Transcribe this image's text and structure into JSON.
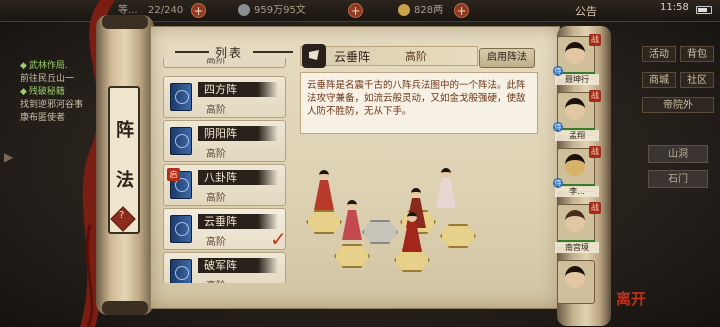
{
  "topbar": {
    "level_text": "等...",
    "stamina": "22/240",
    "silver": "959万95文",
    "gold": "828两",
    "announcement": "公告",
    "time": "11:58"
  },
  "quest": {
    "item1_title": "武林作局.",
    "item1_desc": "前往民丘山一",
    "item2_title": "残破秘籍",
    "item2_desc": "找到逆邪河谷事",
    "item2_desc2": "康布匿使者"
  },
  "right_menu": {
    "btn1": "活动",
    "btn2": "背包",
    "btn3": "商城",
    "btn4": "社区",
    "btn5": "帝院外",
    "btn6": "山洞",
    "btn7": "石门"
  },
  "left_tab": {
    "char1": "阵",
    "char2": "法",
    "seal": "?"
  },
  "list": {
    "header": "列表",
    "items": [
      {
        "name": "四方阵",
        "tier": "高阶",
        "badge": "",
        "selected": false
      },
      {
        "name": "阴阳阵",
        "tier": "高阶",
        "badge": "",
        "selected": false
      },
      {
        "name": "八卦阵",
        "tier": "高阶",
        "badge": "启",
        "selected": false
      },
      {
        "name": "云垂阵",
        "tier": "高阶",
        "badge": "",
        "selected": true
      },
      {
        "name": "破军阵",
        "tier": "高阶",
        "badge": "",
        "selected": false
      }
    ],
    "partial_top_tier": "高阶"
  },
  "detail": {
    "name": "云垂阵",
    "tier": "高阶",
    "enable_button": "启用阵法",
    "description": "云垂阵是名震千古的八阵兵法图中的一个阵法。此阵法攻守兼备，如流云般灵动，又如金戈般强硬，使敌人防不胜防，无从下手。"
  },
  "roster": [
    {
      "name": "聂坤行",
      "badge": "战",
      "tag": "侍"
    },
    {
      "name": "孟翔",
      "badge": "战",
      "tag": "侍"
    },
    {
      "name": "李...",
      "badge": "战",
      "tag": "侍"
    },
    {
      "name": "南宫境",
      "badge": "战",
      "tag": ""
    },
    {
      "name": "",
      "badge": "",
      "tag": ""
    }
  ],
  "corner_seal": "离开"
}
